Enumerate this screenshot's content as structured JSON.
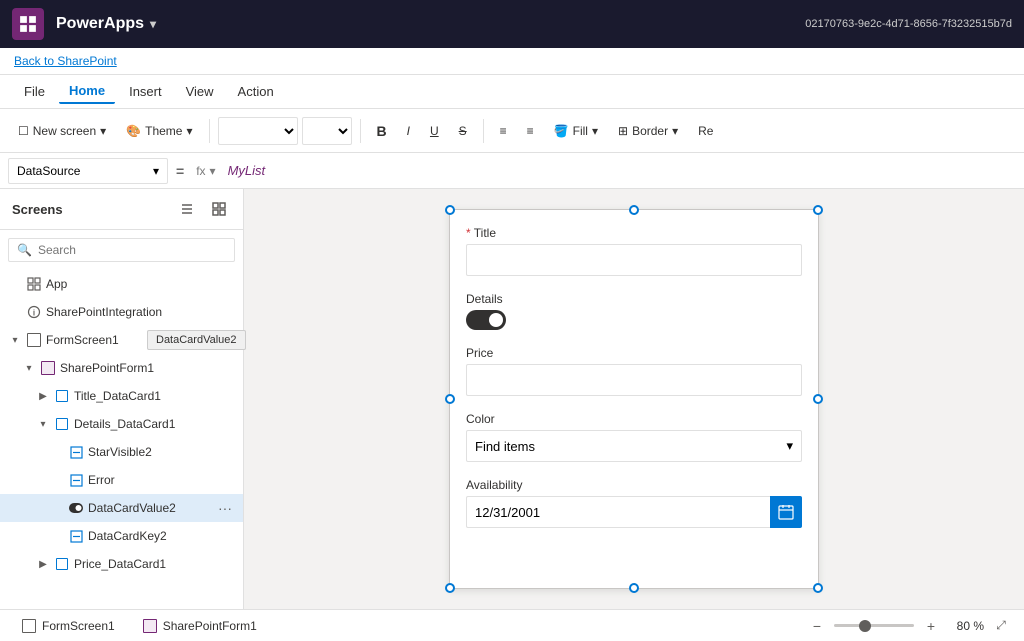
{
  "titlebar": {
    "app_name": "PowerApps",
    "chevron": "▾",
    "session_id": "02170763-9e2c-4d71-8656-7f3232515b7d"
  },
  "back_link": "Back to SharePoint",
  "menu": {
    "items": [
      {
        "label": "File",
        "active": false
      },
      {
        "label": "Home",
        "active": true
      },
      {
        "label": "Insert",
        "active": false
      },
      {
        "label": "View",
        "active": false
      },
      {
        "label": "Action",
        "active": false
      }
    ]
  },
  "toolbar": {
    "new_screen_label": "New screen",
    "theme_label": "Theme",
    "bold_label": "B",
    "fill_label": "Fill",
    "border_label": "Border",
    "re_label": "Re"
  },
  "formula_bar": {
    "property": "DataSource",
    "equals": "=",
    "fx_label": "fx",
    "formula_value": "MyList"
  },
  "sidebar": {
    "title": "Screens",
    "search_placeholder": "Search",
    "tree_items": [
      {
        "id": "app",
        "label": "App",
        "indent": 1,
        "chevron": "",
        "icon": "app",
        "level": 1
      },
      {
        "id": "sharepoint-integration",
        "label": "SharePointIntegration",
        "indent": 1,
        "icon": "circle-info",
        "level": 1
      },
      {
        "id": "formscreen1",
        "label": "FormScreen1",
        "indent": 1,
        "chevron": "▾",
        "icon": "rect",
        "level": 1,
        "expanded": true
      },
      {
        "id": "sharepointform1",
        "label": "SharePointForm1",
        "indent": 2,
        "chevron": "▾",
        "icon": "form",
        "level": 2,
        "expanded": true
      },
      {
        "id": "title-datacard1",
        "label": "Title_DataCard1",
        "indent": 3,
        "chevron": "▶",
        "icon": "card",
        "level": 3
      },
      {
        "id": "details-datacard1",
        "label": "Details_DataCard1",
        "indent": 3,
        "chevron": "▾",
        "icon": "card",
        "level": 3,
        "expanded": true
      },
      {
        "id": "starvisible2",
        "label": "StarVisible2",
        "indent": 4,
        "icon": "pencil",
        "level": 4
      },
      {
        "id": "error",
        "label": "Error",
        "indent": 4,
        "icon": "pencil",
        "level": 4
      },
      {
        "id": "datacardvalue2",
        "label": "DataCardValue2",
        "indent": 4,
        "icon": "toggle",
        "level": 4,
        "selected": true
      },
      {
        "id": "datacardkey2",
        "label": "DataCardKey2",
        "indent": 4,
        "icon": "pencil",
        "level": 4
      },
      {
        "id": "price-datacard1",
        "label": "Price_DataCard1",
        "indent": 3,
        "chevron": "▶",
        "icon": "card",
        "level": 3
      }
    ]
  },
  "tooltip": {
    "text": "DataCardValue2"
  },
  "canvas": {
    "form": {
      "title_label": "Title",
      "title_required": true,
      "title_value": "",
      "details_label": "Details",
      "details_toggle_on": true,
      "price_label": "Price",
      "price_value": "",
      "color_label": "Color",
      "color_placeholder": "Find items",
      "availability_label": "Availability",
      "availability_date": "12/31/2001"
    }
  },
  "statusbar": {
    "screen_tab": "FormScreen1",
    "form_tab": "SharePointForm1",
    "zoom_minus": "−",
    "zoom_plus": "+",
    "zoom_value": "80 %",
    "expand_icon": "⤢"
  }
}
